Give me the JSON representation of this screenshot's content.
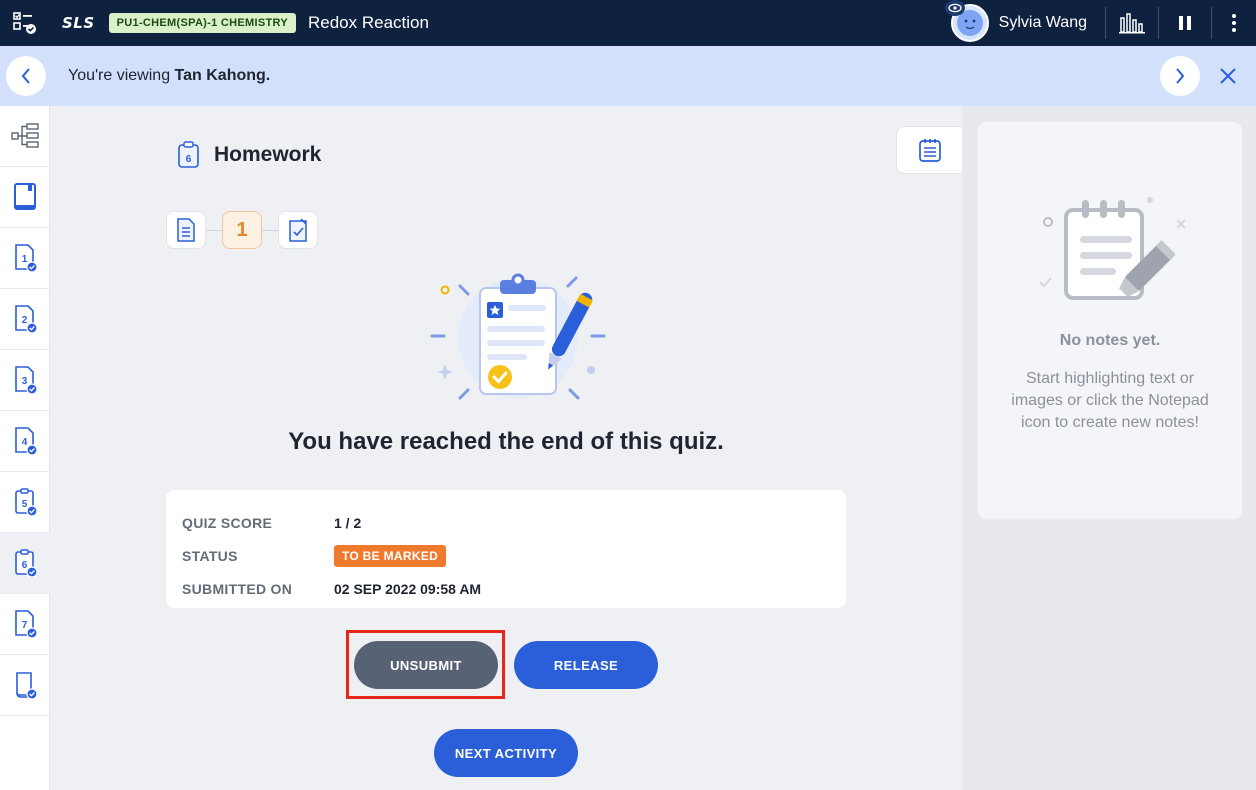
{
  "topbar": {
    "logo": "SLS",
    "badge": "PU1-CHEM(SPA)-1 CHEMISTRY",
    "title": "Redox Reaction",
    "user_name": "Sylvia Wang"
  },
  "viewing": {
    "prefix": "You're viewing ",
    "student": "Tan Kahong."
  },
  "rail": {
    "items": [
      "",
      "",
      "1",
      "2",
      "3",
      "4",
      "5",
      "6",
      "7",
      ""
    ]
  },
  "main": {
    "heading_icon_number": "6",
    "heading": "Homework",
    "step_number": "1",
    "end_message": "You have reached the end of this quiz.",
    "score_card": {
      "quiz_score_label": "QUIZ SCORE",
      "quiz_score_value": "1 / 2",
      "status_label": "STATUS",
      "status_value": "TO BE MARKED",
      "submitted_label": "SUBMITTED ON",
      "submitted_value": "02 SEP 2022 09:58 AM"
    },
    "buttons": {
      "unsubmit": "UNSUBMIT",
      "release": "RELEASE",
      "next": "NEXT ACTIVITY"
    }
  },
  "notes": {
    "title": "No notes yet.",
    "description": "Start highlighting text or images or click the Notepad icon to create new notes!"
  },
  "colors": {
    "topbar": "#0e2240",
    "accent": "#2b5fd9",
    "status": "#ef7a2d",
    "highlight": "#e8261c"
  }
}
